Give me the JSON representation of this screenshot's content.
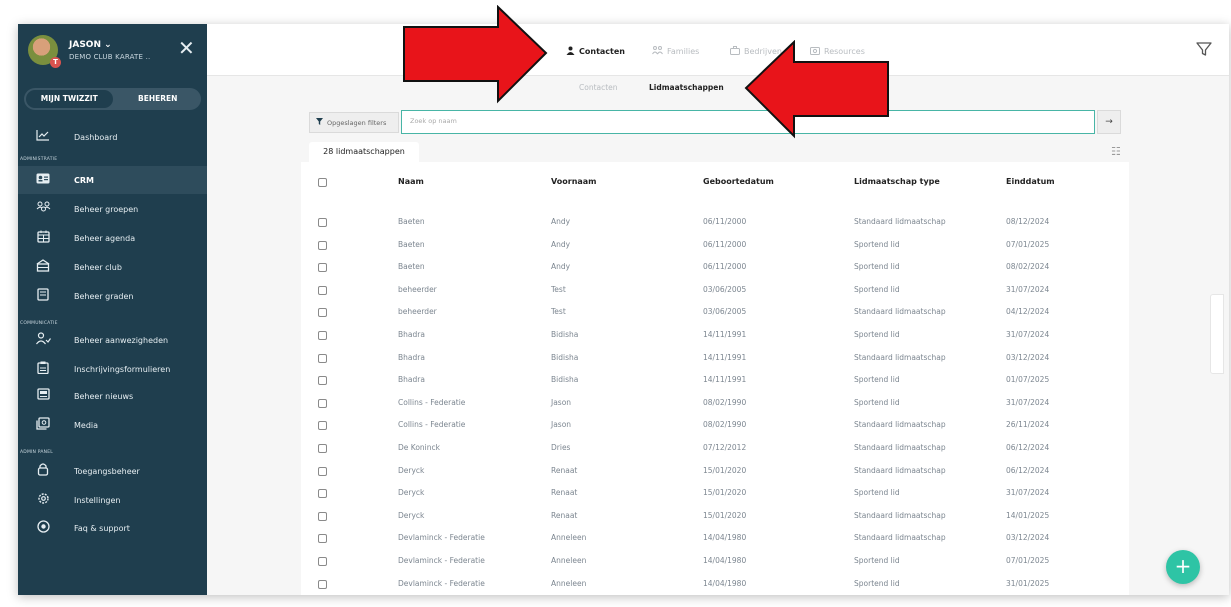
{
  "user": {
    "name": "JASON ⌄",
    "club": "DEMO CLUB KARATE ..",
    "badge": "T"
  },
  "mode": {
    "left": "MIJN TWIZZIT",
    "right": "BEHEREN"
  },
  "sidebar": {
    "dashboard": "Dashboard",
    "section_admin": "ADMINISTRATIE",
    "section_comm": "COMMUNICATIE",
    "section_panel": "ADMIN PANEL",
    "items": [
      {
        "label": "CRM",
        "icon": "id-card-icon"
      },
      {
        "label": "Beheer groepen",
        "icon": "groups-icon"
      },
      {
        "label": "Beheer agenda",
        "icon": "calendar-icon"
      },
      {
        "label": "Beheer club",
        "icon": "building-icon"
      },
      {
        "label": "Beheer graden",
        "icon": "book-icon"
      },
      {
        "label": "Beheer aanwezigheden",
        "icon": "user-check-icon"
      },
      {
        "label": "Inschrijvingsformulieren",
        "icon": "clipboard-icon"
      },
      {
        "label": "Beheer nieuws",
        "icon": "news-icon"
      },
      {
        "label": "Media",
        "icon": "media-icon"
      },
      {
        "label": "Toegangsbeheer",
        "icon": "lock-icon"
      },
      {
        "label": "Instellingen",
        "icon": "gear-icon"
      },
      {
        "label": "Faq & support",
        "icon": "support-icon"
      }
    ]
  },
  "tabs": {
    "contacten": "Contacten",
    "families": "Families",
    "bedrijven": "Bedrijven",
    "resources": "Resources"
  },
  "subtabs": {
    "contacten": "Contacten",
    "lidmaatschappen": "Lidmaatschappen"
  },
  "filters": {
    "saved": "Opgeslagen filters",
    "search_placeholder": "Zoek op naam",
    "go": "→"
  },
  "count_label": "28 lidmaatschappen",
  "table": {
    "headers": [
      "Naam",
      "Voornaam",
      "Geboortedatum",
      "Lidmaatschap type",
      "Einddatum"
    ],
    "rows": [
      [
        "Baeten",
        "Andy",
        "06/11/2000",
        "Standaard lidmaatschap",
        "08/12/2024"
      ],
      [
        "Baeten",
        "Andy",
        "06/11/2000",
        "Sportend lid",
        "07/01/2025"
      ],
      [
        "Baeten",
        "Andy",
        "06/11/2000",
        "Sportend lid",
        "08/02/2024"
      ],
      [
        "beheerder",
        "Test",
        "03/06/2005",
        "Sportend lid",
        "31/07/2024"
      ],
      [
        "beheerder",
        "Test",
        "03/06/2005",
        "Standaard lidmaatschap",
        "04/12/2024"
      ],
      [
        "Bhadra",
        "Bidisha",
        "14/11/1991",
        "Sportend lid",
        "31/07/2024"
      ],
      [
        "Bhadra",
        "Bidisha",
        "14/11/1991",
        "Standaard lidmaatschap",
        "03/12/2024"
      ],
      [
        "Bhadra",
        "Bidisha",
        "14/11/1991",
        "Sportend lid",
        "01/07/2025"
      ],
      [
        "Collins - Federatie",
        "Jason",
        "08/02/1990",
        "Sportend lid",
        "31/07/2024"
      ],
      [
        "Collins - Federatie",
        "Jason",
        "08/02/1990",
        "Standaard lidmaatschap",
        "26/11/2024"
      ],
      [
        "De Koninck",
        "Dries",
        "07/12/2012",
        "Standaard lidmaatschap",
        "06/12/2024"
      ],
      [
        "Deryck",
        "Renaat",
        "15/01/2020",
        "Standaard lidmaatschap",
        "06/12/2024"
      ],
      [
        "Deryck",
        "Renaat",
        "15/01/2020",
        "Sportend lid",
        "31/07/2024"
      ],
      [
        "Deryck",
        "Renaat",
        "15/01/2020",
        "Standaard lidmaatschap",
        "14/01/2025"
      ],
      [
        "Devlaminck - Federatie",
        "Anneleen",
        "14/04/1980",
        "Standaard lidmaatschap",
        "03/12/2024"
      ],
      [
        "Devlaminck - Federatie",
        "Anneleen",
        "14/04/1980",
        "Sportend lid",
        "07/01/2025"
      ],
      [
        "Devlaminck - Federatie",
        "Anneleen",
        "14/04/1980",
        "Sportend lid",
        "31/01/2025"
      ]
    ]
  },
  "fab_label": "+",
  "colors": {
    "sidebar": "#1f3e4e",
    "accent": "#48b5a6",
    "fab": "#2ec4a5",
    "arrow": "#e8141a"
  }
}
